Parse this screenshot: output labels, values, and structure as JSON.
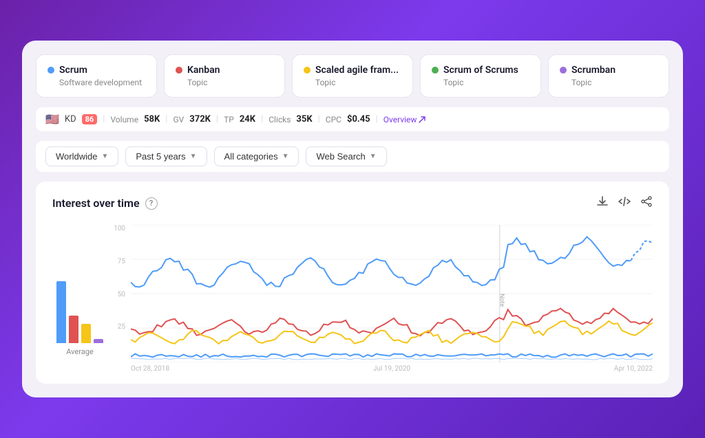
{
  "topics": [
    {
      "id": "scrum",
      "name": "Scrum",
      "subtitle": "Software development",
      "color": "#4f9cf9",
      "dotColor": "#4f9cf9"
    },
    {
      "id": "kanban",
      "name": "Kanban",
      "subtitle": "Topic",
      "color": "#e05252",
      "dotColor": "#e05252"
    },
    {
      "id": "scaled",
      "name": "Scaled agile fram...",
      "subtitle": "Topic",
      "color": "#f5c518",
      "dotColor": "#f5c518"
    },
    {
      "id": "scrum-of-scrums",
      "name": "Scrum of Scrums",
      "subtitle": "Topic",
      "color": "#4caf50",
      "dotColor": "#4caf50"
    },
    {
      "id": "scrumban",
      "name": "Scrumban",
      "subtitle": "Topic",
      "color": "#9c6fdb",
      "dotColor": "#9c6fdb"
    }
  ],
  "stats": {
    "flag": "🇺🇸",
    "kd_label": "KD",
    "kd_value": "86",
    "volume_label": "Volume",
    "volume_value": "58K",
    "gv_label": "GV",
    "gv_value": "372K",
    "tp_label": "TP",
    "tp_value": "24K",
    "clicks_label": "Clicks",
    "clicks_value": "35K",
    "cpc_label": "CPC",
    "cpc_value": "$0.45",
    "overview_label": "Overview"
  },
  "filters": [
    {
      "id": "location",
      "label": "Worldwide"
    },
    {
      "id": "period",
      "label": "Past 5 years"
    },
    {
      "id": "category",
      "label": "All categories"
    },
    {
      "id": "type",
      "label": "Web Search"
    }
  ],
  "chart": {
    "title": "Interest over time",
    "y_labels": [
      "100",
      "75",
      "50",
      "25",
      ""
    ],
    "x_labels": [
      "Oct 28, 2018",
      "Jul 19, 2020",
      "Apr 10, 2022"
    ],
    "avg_label": "Average",
    "note_label": "Note",
    "download_icon": "⬇",
    "embed_icon": "<>",
    "share_icon": "⤢"
  },
  "avg_bars": [
    {
      "color": "#4f9cf9",
      "height": 90
    },
    {
      "color": "#e05252",
      "height": 40
    },
    {
      "color": "#f5c518",
      "height": 28
    },
    {
      "color": "#9c6fdb",
      "height": 6
    }
  ]
}
